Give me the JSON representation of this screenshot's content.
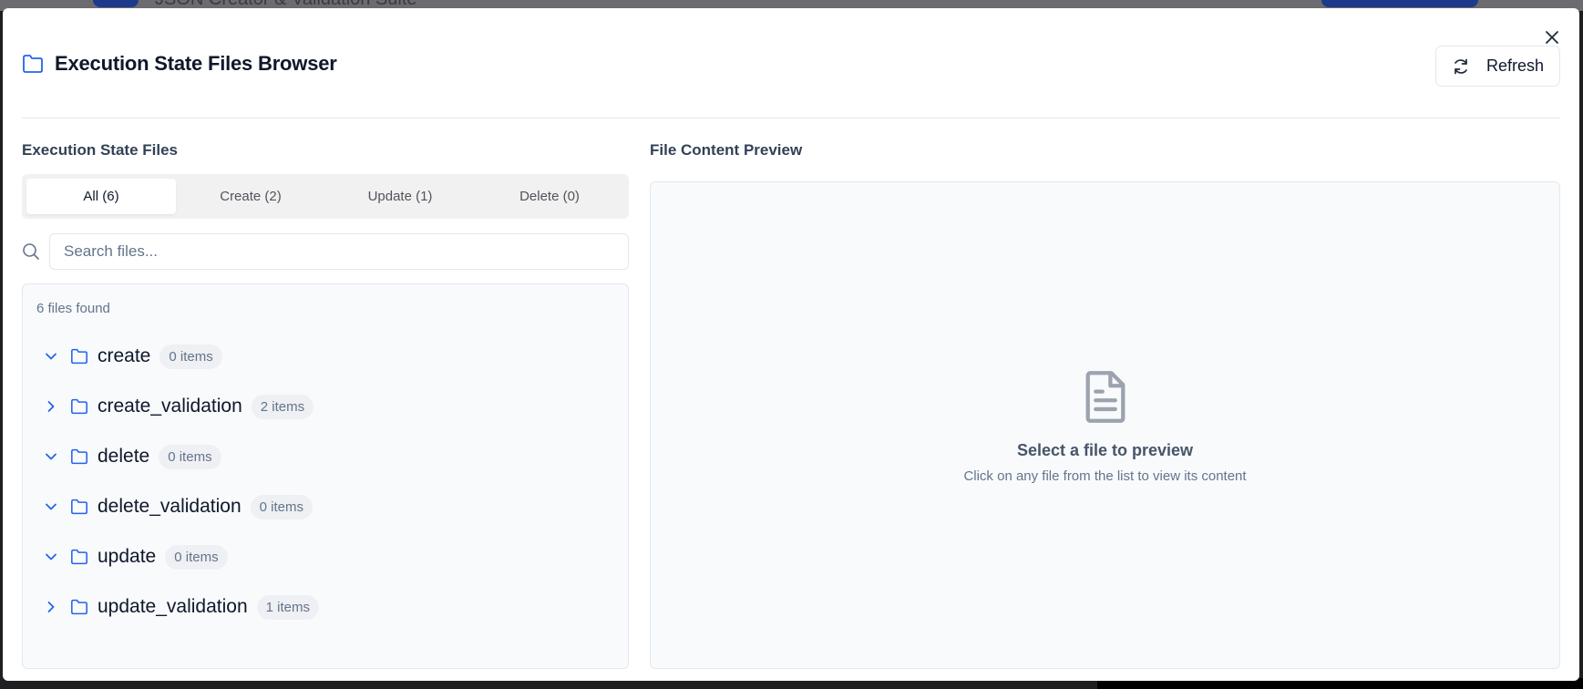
{
  "backdrop": {
    "app_title": "JSON Creator & Validation Suite"
  },
  "dialog": {
    "title": "Execution State Files Browser",
    "refresh_label": "Refresh"
  },
  "files_panel": {
    "title": "Execution State Files",
    "tabs": [
      {
        "label": "All (6)",
        "active": true
      },
      {
        "label": "Create (2)",
        "active": false
      },
      {
        "label": "Update (1)",
        "active": false
      },
      {
        "label": "Delete (0)",
        "active": false
      }
    ],
    "search": {
      "placeholder": "Search files...",
      "value": ""
    },
    "count_text": "6 files found",
    "folders": [
      {
        "name": "create",
        "count": "0 items",
        "expanded": true
      },
      {
        "name": "create_validation",
        "count": "2 items",
        "expanded": false
      },
      {
        "name": "delete",
        "count": "0 items",
        "expanded": true
      },
      {
        "name": "delete_validation",
        "count": "0 items",
        "expanded": true
      },
      {
        "name": "update",
        "count": "0 items",
        "expanded": true
      },
      {
        "name": "update_validation",
        "count": "1 items",
        "expanded": false
      }
    ]
  },
  "preview_panel": {
    "title": "File Content Preview",
    "empty_title": "Select a file to preview",
    "empty_subtitle": "Click on any file from the list to view its content"
  },
  "colors": {
    "accent": "#2563eb",
    "muted_icon": "#9ca3af"
  }
}
